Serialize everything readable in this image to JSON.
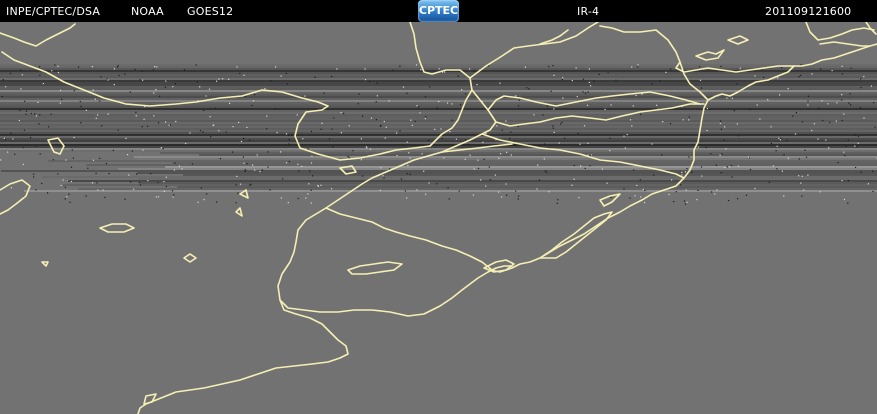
{
  "header": {
    "source": "INPE/CPTEC/DSA",
    "agency": "NOAA",
    "satellite": "GOES12",
    "logo_text": "CPTEC",
    "channel": "IR-4",
    "timestamp": "201109121600"
  },
  "colors": {
    "background": "#727272",
    "coastline": "#f5efb4",
    "header_bg": "#000000",
    "header_text": "#ffffff"
  },
  "layers": {
    "coastlines": "coastline-and-borders",
    "imagery": "infrared-scanline-noise"
  }
}
